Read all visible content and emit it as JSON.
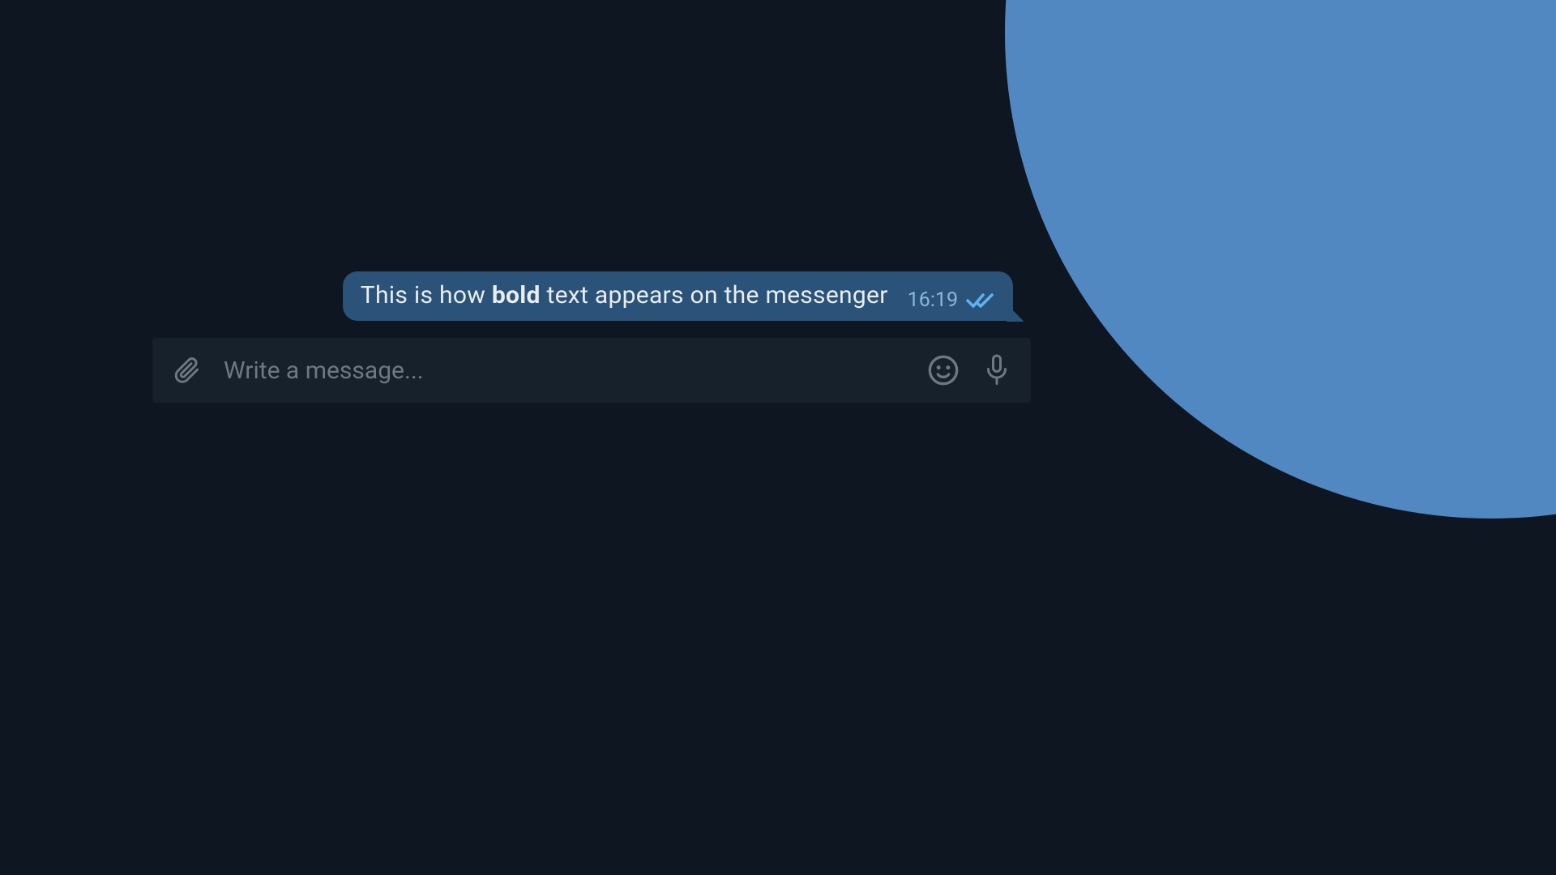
{
  "message": {
    "text_before": "This is how ",
    "text_bold": "bold",
    "text_after": " text appears on the messenger",
    "timestamp": "16:19",
    "status": "read"
  },
  "input": {
    "placeholder": "Write a message..."
  },
  "colors": {
    "background": "#0e1621",
    "bubble": "#2b5278",
    "inputBar": "#17212b",
    "iconGray": "#6d7883",
    "checkBlue": "#5fb2f2",
    "accentCircle": "#5288c1"
  }
}
